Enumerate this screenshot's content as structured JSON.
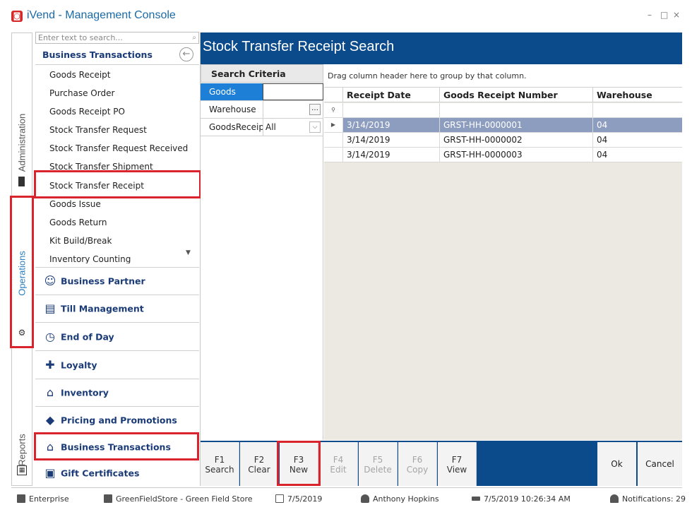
{
  "window": {
    "logo_glyph": "◙",
    "title": "iVend - Management Console",
    "minimize": "–",
    "maximize": "□",
    "close": "×"
  },
  "vtabs": {
    "administration": "Administration",
    "operations": "Operations",
    "reports": "Reports"
  },
  "nav": {
    "search_placeholder": "Enter text to search...",
    "header": "Business Transactions",
    "items": [
      "Goods Receipt",
      "Purchase Order",
      "Goods Receipt PO",
      "Stock Transfer Request",
      "Stock Transfer Request Received",
      "Stock Transfer Shipment",
      "Stock Transfer Receipt",
      "Goods Issue",
      "Goods Return",
      "Kit Build/Break",
      "Inventory Counting"
    ],
    "groups": [
      {
        "label": "Business Partner",
        "icon": "business-partner-icon",
        "glyph": "☺"
      },
      {
        "label": "Till Management",
        "icon": "till-icon",
        "glyph": "▤"
      },
      {
        "label": "End of Day",
        "icon": "clock-icon",
        "glyph": "◷"
      },
      {
        "label": "Loyalty",
        "icon": "gift-icon",
        "glyph": "✚"
      },
      {
        "label": "Inventory",
        "icon": "warehouse-icon",
        "glyph": "⌂"
      },
      {
        "label": "Pricing and Promotions",
        "icon": "tag-icon",
        "glyph": "◆"
      },
      {
        "label": "Business Transactions",
        "icon": "warehouse-icon",
        "glyph": "⌂"
      },
      {
        "label": "Gift Certificates",
        "icon": "certificate-icon",
        "glyph": "▣"
      }
    ]
  },
  "main": {
    "title": "Stock Transfer Receipt Search",
    "criteria": {
      "header": "Search Criteria",
      "rows": [
        {
          "label": "Goods",
          "value": ""
        },
        {
          "label": "Warehouse",
          "value": ""
        },
        {
          "label": "GoodsReceip",
          "value": "All"
        }
      ]
    },
    "grid": {
      "group_hint": "Drag column header here to group by that column.",
      "columns": [
        "Receipt Date",
        "Goods Receipt Number",
        "Warehouse"
      ],
      "rows": [
        [
          "3/14/2019",
          "GRST-HH-0000001",
          "04"
        ],
        [
          "3/14/2019",
          "GRST-HH-0000002",
          "04"
        ],
        [
          "3/14/2019",
          "GRST-HH-0000003",
          "04"
        ]
      ]
    }
  },
  "toolbar": {
    "buttons": [
      {
        "key": "F1",
        "label": "Search",
        "enabled": true
      },
      {
        "key": "F2",
        "label": "Clear",
        "enabled": true
      },
      {
        "key": "F3",
        "label": "New",
        "enabled": true
      },
      {
        "key": "F4",
        "label": "Edit",
        "enabled": false
      },
      {
        "key": "F5",
        "label": "Delete",
        "enabled": false
      },
      {
        "key": "F6",
        "label": "Copy",
        "enabled": false
      },
      {
        "key": "F7",
        "label": "View",
        "enabled": true
      }
    ],
    "ok": "Ok",
    "cancel": "Cancel"
  },
  "status": {
    "edition": "Enterprise",
    "store": "GreenFieldStore - Green Field Store",
    "date": "7/5/2019",
    "user": "Anthony Hopkins",
    "login_time": "7/5/2019 10:26:34 AM",
    "notifications": "Notifications: 29"
  },
  "colors": {
    "title_blue": "#0b4a8b",
    "nav_text": "#1a3b78",
    "highlight_red": "#d9232d",
    "selected_row": "#8d9dbf",
    "selected_criteria": "#1e7fd6"
  }
}
